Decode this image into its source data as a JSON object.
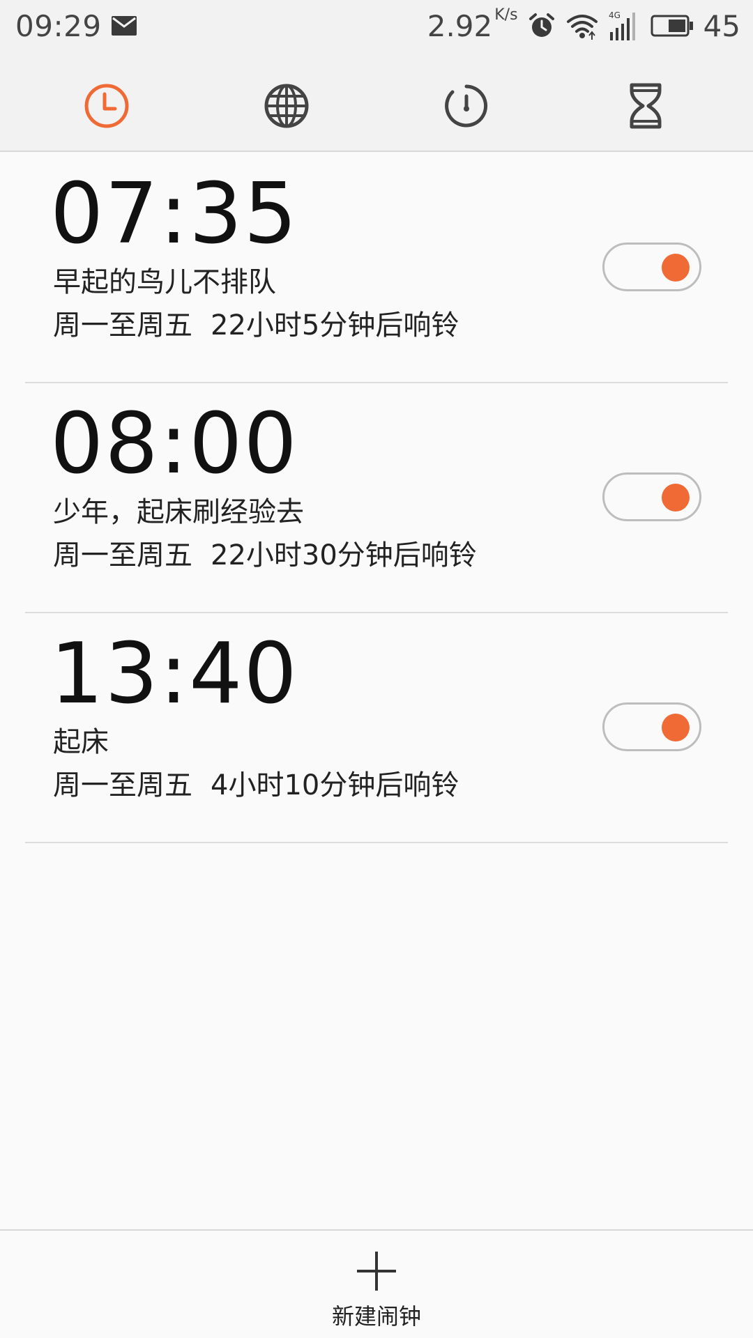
{
  "status_bar": {
    "time": "09:29",
    "net_speed": "2.92",
    "net_speed_unit": "K/s",
    "network_type": "4G",
    "battery": "45",
    "icons": [
      "mail-icon",
      "alarm-clock-icon",
      "wifi-icon",
      "signal-icon",
      "battery-icon"
    ]
  },
  "tabs": [
    {
      "icon": "clock-icon",
      "active": true
    },
    {
      "icon": "globe-icon",
      "active": false
    },
    {
      "icon": "stopwatch-icon",
      "active": false
    },
    {
      "icon": "hourglass-icon",
      "active": false
    }
  ],
  "colors": {
    "accent": "#f06a35",
    "icon_gray": "#444444",
    "background": "#fafafa",
    "header_bg": "#f2f2f2"
  },
  "alarms": [
    {
      "time": "07:35",
      "label": "早起的鸟儿不排队",
      "repeat": "周一至周五",
      "countdown": "22小时5分钟后响铃",
      "enabled": true
    },
    {
      "time": "08:00",
      "label": "少年，起床刷经验去",
      "repeat": "周一至周五",
      "countdown": "22小时30分钟后响铃",
      "enabled": true
    },
    {
      "time": "13:40",
      "label": "起床",
      "repeat": "周一至周五",
      "countdown": "4小时10分钟后响铃",
      "enabled": true
    }
  ],
  "bottom": {
    "new_alarm_label": "新建闹钟"
  }
}
